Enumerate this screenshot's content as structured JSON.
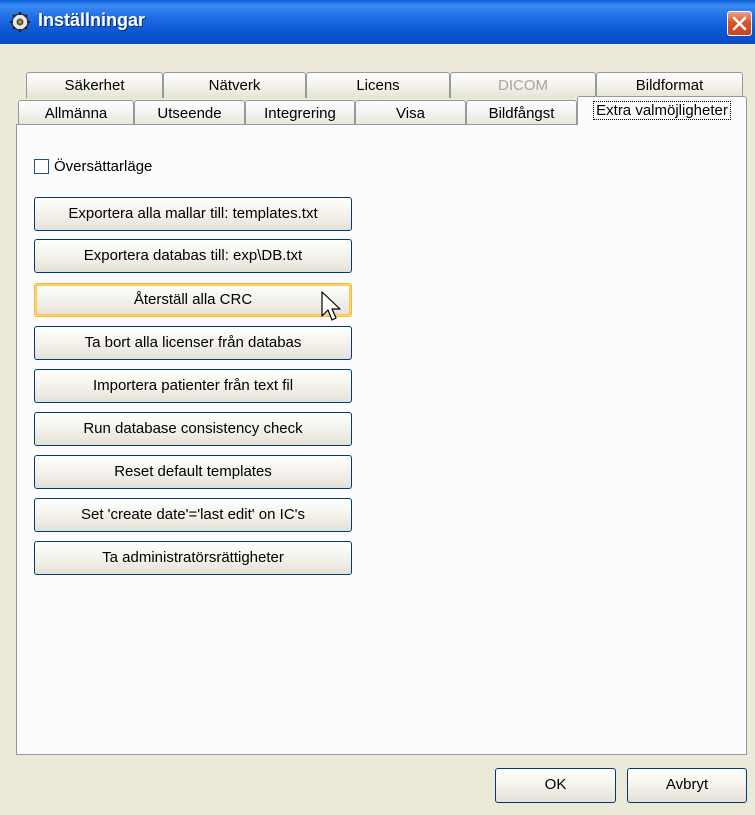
{
  "window": {
    "title": "Inställningar"
  },
  "tabs_row1": [
    {
      "label": "Säkerhet",
      "disabled": false
    },
    {
      "label": "Nätverk",
      "disabled": false
    },
    {
      "label": "Licens",
      "disabled": false
    },
    {
      "label": "DICOM",
      "disabled": true
    },
    {
      "label": "Bildformat",
      "disabled": false
    }
  ],
  "tabs_row2": [
    {
      "label": "Allmänna"
    },
    {
      "label": "Utseende"
    },
    {
      "label": "Integrering"
    },
    {
      "label": "Visa"
    },
    {
      "label": "Bildfångst"
    },
    {
      "label": "Extra valmöjligheter",
      "active": true
    }
  ],
  "panel": {
    "checkbox_label": "Översättarläge",
    "checkbox_checked": false,
    "buttons": [
      "Exportera alla mallar till: templates.txt",
      "Exportera databas till: exp\\DB.txt",
      "Återställ alla CRC",
      "Ta bort alla licenser från databas",
      "Importera patienter från text fil",
      "Run database consistency check",
      "Reset default templates",
      "Set 'create date'='last edit' on IC's",
      "Ta administratörsrättigheter"
    ]
  },
  "footer": {
    "ok": "OK",
    "cancel": "Avbryt"
  }
}
